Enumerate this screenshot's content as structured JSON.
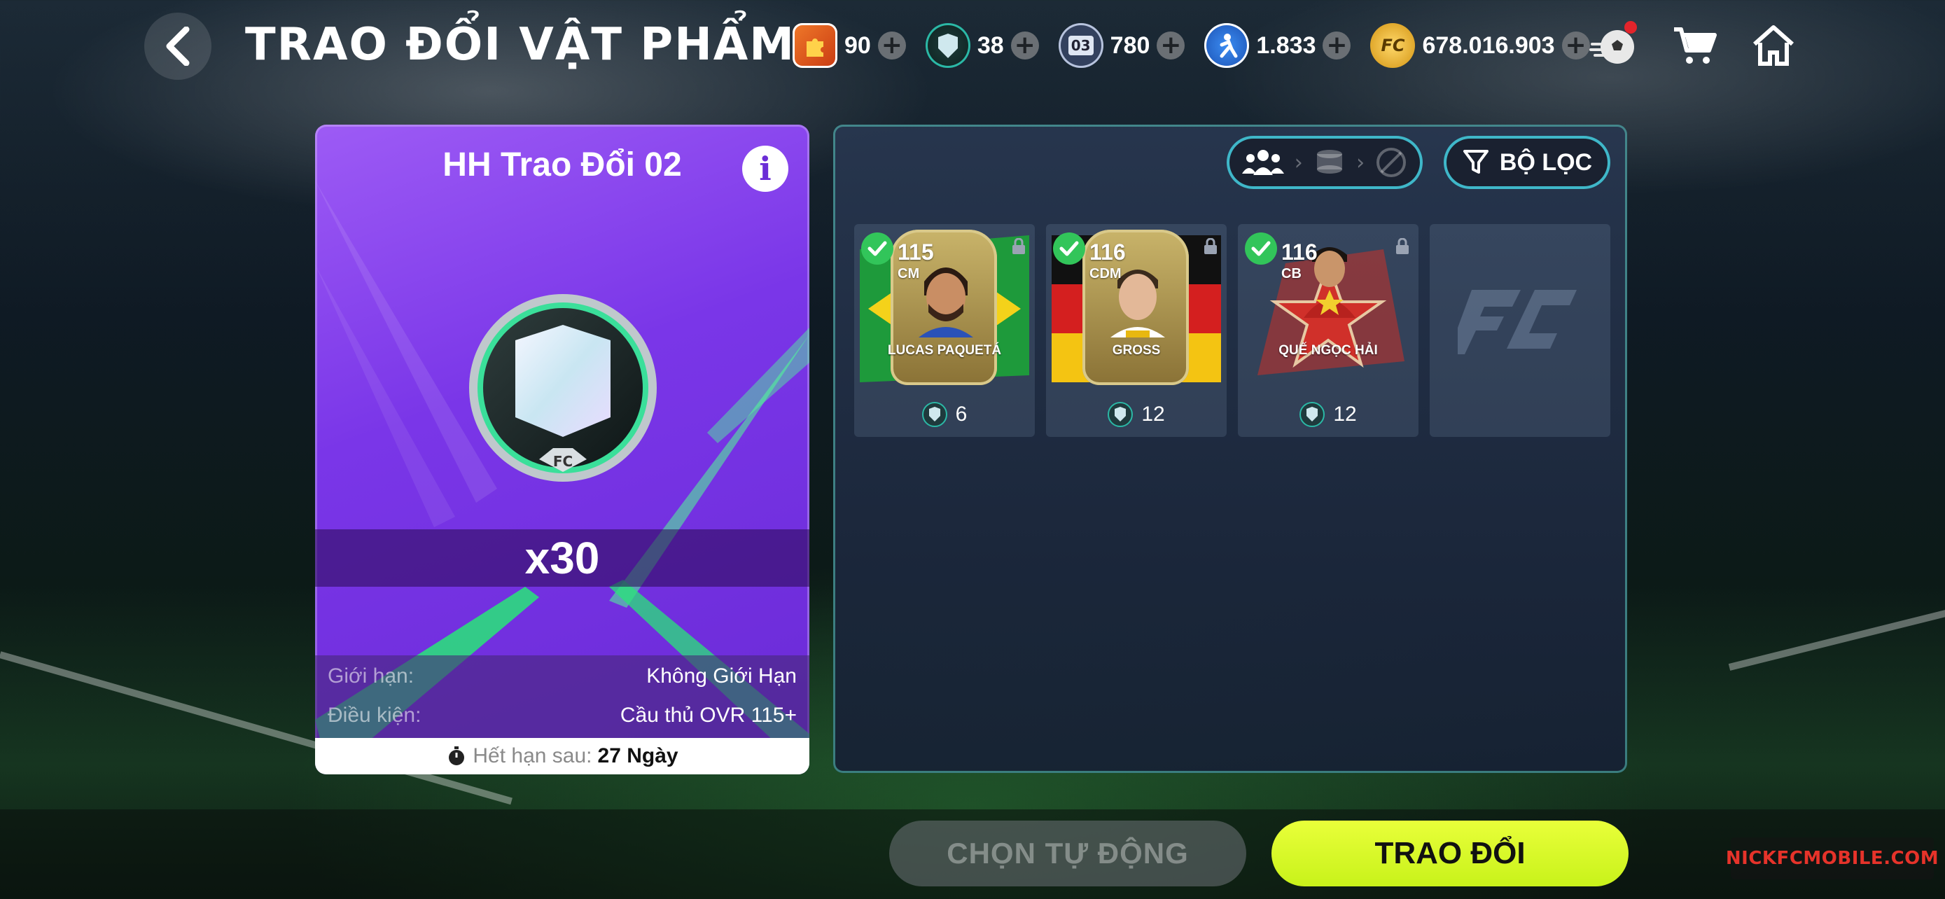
{
  "header": {
    "title": "TRAO ĐỔI VẬT PHẨM",
    "currencies": [
      {
        "name": "puzzle-token",
        "value": "90",
        "color": "#e8561b"
      },
      {
        "name": "trade-gem",
        "value": "38",
        "color": "#2bb8a6"
      },
      {
        "name": "season-token",
        "value": "780",
        "color": "#4a5d84"
      },
      {
        "name": "player-token",
        "value": "1.833",
        "color": "#2e73e6"
      },
      {
        "name": "fc-coin",
        "value": "678.016.903",
        "color": "#f0b11a"
      }
    ],
    "icons": [
      "back-icon",
      "soccer-ball-icon",
      "cart-icon",
      "home-icon"
    ]
  },
  "exchange_card": {
    "title": "HH Trao Đổi 02",
    "quantity": "x30",
    "limit_label": "Giới hạn:",
    "limit_value": "Không Giới Hạn",
    "condition_label": "Điều kiện:",
    "condition_value": "Cầu thủ OVR 115+",
    "expiry_label": "Hết hạn sau:",
    "expiry_value": "27 Ngày"
  },
  "filter": {
    "label": "BỘ LỌC"
  },
  "players": [
    {
      "ovr": "115",
      "position": "CM",
      "name": "LUCAS PAQUETÁ",
      "cost": "6",
      "selected": true
    },
    {
      "ovr": "116",
      "position": "CDM",
      "name": "GROSS",
      "cost": "12",
      "selected": true
    },
    {
      "ovr": "116",
      "position": "CB",
      "name": "QUẾ NGỌC HẢI",
      "cost": "12",
      "selected": true
    }
  ],
  "actions": {
    "auto_select": "CHỌN TỰ ĐỘNG",
    "trade": "TRAO ĐỔI"
  },
  "watermark": "NICKFCMOBILE.COM",
  "colors": {
    "accent_lime": "#d8f52a",
    "card_purple": "#7a36e8",
    "panel_border": "#3fb7c9",
    "check_green": "#32c55a"
  }
}
